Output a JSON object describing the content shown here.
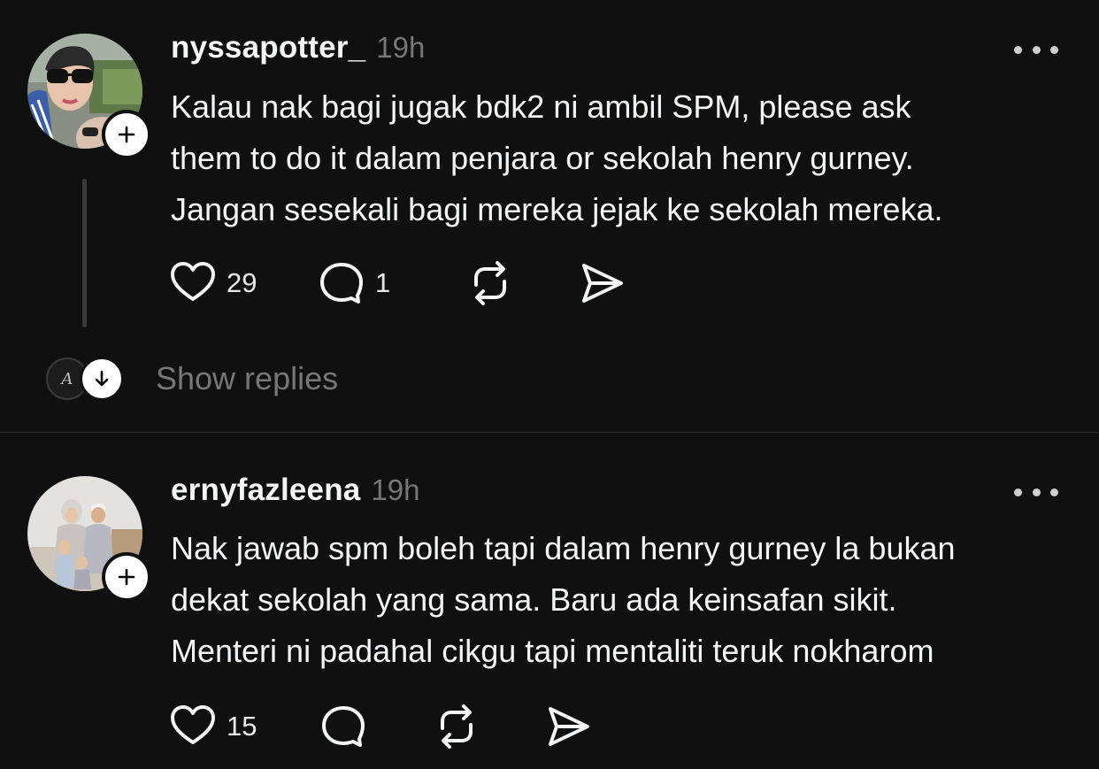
{
  "posts": [
    {
      "username": "nyssapotter_",
      "time": "19h",
      "lines": [
        "Kalau nak bagi jugak bdk2 ni ambil SPM, please ask",
        "them to do it dalam penjara or sekolah henry gurney.",
        "Jangan sesekali bagi mereka jejak ke sekolah mereka."
      ],
      "likes": "29",
      "replies": "1",
      "show_replies_label": "Show replies",
      "reply_avatar_letter": "A"
    },
    {
      "username": "ernyfazleena",
      "time": "19h",
      "lines": [
        "Nak jawab spm boleh tapi dalam henry gurney la bukan",
        "dekat sekolah yang sama. Baru ada keinsafan sikit.",
        "Menteri ni padahal cikgu tapi mentaliti teruk nokharom"
      ],
      "likes": "15"
    }
  ],
  "icons": {
    "like": "heart-icon",
    "reply": "speech-bubble-icon",
    "repost": "repost-arrows-icon",
    "share": "send-icon",
    "follow": "plus-icon",
    "more": "more-dots-icon",
    "expand": "arrow-down-icon"
  },
  "colors": {
    "background": "#101010",
    "text": "#f3f5f7",
    "muted": "#777777",
    "divider": "#2e2e2e"
  }
}
